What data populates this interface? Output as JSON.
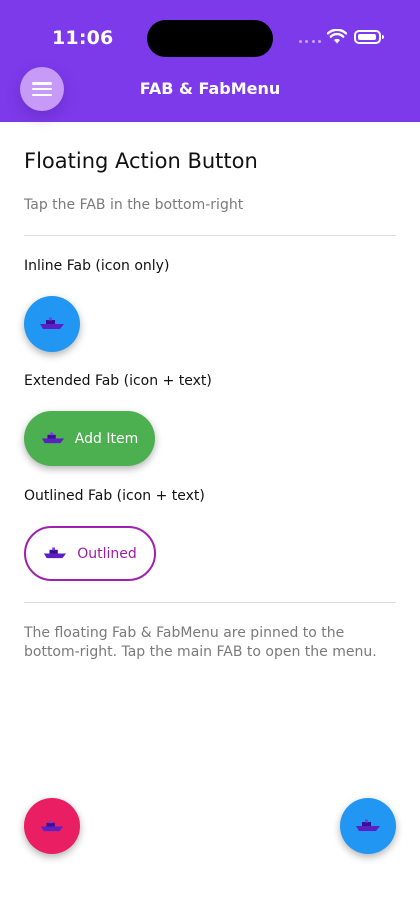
{
  "status_bar": {
    "time": "11:06"
  },
  "app_bar": {
    "title": "FAB & FabMenu",
    "menu_icon": "hamburger-icon",
    "color": "#7c3aea",
    "menu_button_color": "#c79af7"
  },
  "content": {
    "title": "Floating Action Button",
    "subtitle": "Tap the FAB in the bottom-right",
    "sections": [
      {
        "label": "Inline Fab (icon only)",
        "fab": {
          "icon": "ship-icon",
          "color": "#2196f3"
        }
      },
      {
        "label": "Extended Fab (icon + text)",
        "fab": {
          "icon": "ship-icon",
          "text": "Add Item",
          "color": "#4caf50"
        }
      },
      {
        "label": "Outlined Fab (icon + text)",
        "fab": {
          "icon": "ship-icon",
          "text": "Outlined",
          "color": "#a020b0"
        }
      }
    ],
    "footer_note": "The floating Fab & FabMenu are pinned to the bottom-right. Tap the main FAB to open the menu."
  },
  "floating": {
    "left_fab": {
      "icon": "ship-icon",
      "color": "#e91e63"
    },
    "right_fab": {
      "icon": "ship-icon",
      "color": "#2196f3"
    }
  }
}
